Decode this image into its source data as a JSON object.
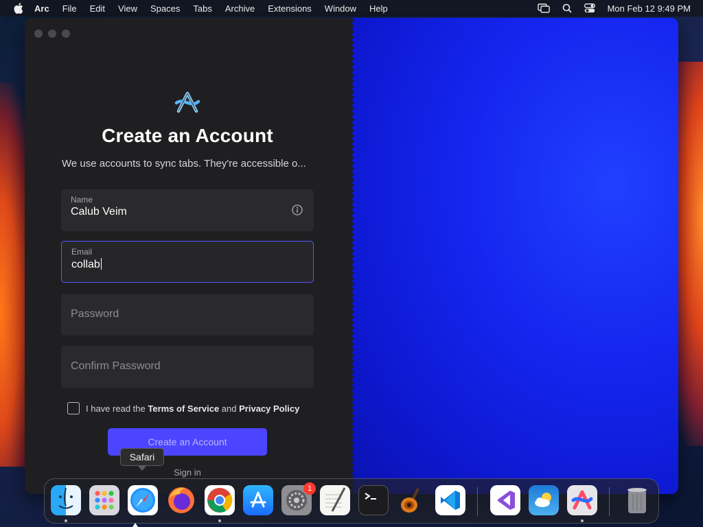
{
  "menubar": {
    "app_name": "Arc",
    "items": [
      "File",
      "Edit",
      "View",
      "Spaces",
      "Tabs",
      "Archive",
      "Extensions",
      "Window",
      "Help"
    ],
    "clock": "Mon Feb 12  9:49 PM"
  },
  "signup": {
    "title": "Create an Account",
    "subtitle": "We use accounts to sync tabs. They're accessible o...",
    "name_label": "Name",
    "name_value": "Calub Veim",
    "email_label": "Email",
    "email_value": "collab",
    "password_placeholder": "Password",
    "confirm_placeholder": "Confirm Password",
    "terms_prefix": "I have read the",
    "terms_link": "Terms of Service",
    "terms_and": "and",
    "privacy_link": "Privacy Policy",
    "terms_checked": false,
    "create_button": "Create an Account",
    "sign_in": "Sign in"
  },
  "tooltip": "Safari",
  "dock": {
    "apps": [
      "finder",
      "launchpad",
      "safari",
      "firefox",
      "chrome",
      "app-store",
      "system-settings",
      "textedit",
      "terminal",
      "garageband",
      "vscode",
      "visual-studio",
      "weather",
      "arc",
      "trash"
    ],
    "system_settings_badge": "1"
  },
  "colors": {
    "accent": "#4b45ff",
    "right_pane": "#1526f0",
    "pane_bg": "#1f1f21"
  }
}
